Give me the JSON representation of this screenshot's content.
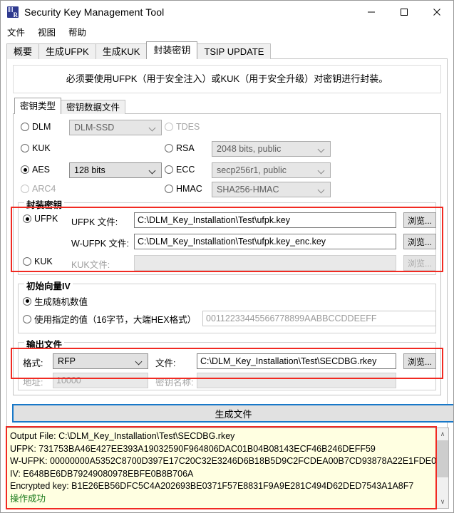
{
  "window": {
    "title": "Security Key Management Tool",
    "icon": "app-icon",
    "minimize": "–",
    "maximize": "□",
    "close": "✕"
  },
  "menu": {
    "items": [
      "文件",
      "视图",
      "帮助"
    ]
  },
  "tabs": {
    "items": [
      {
        "label": "概要",
        "active": false
      },
      {
        "label": "生成UFPK",
        "active": false
      },
      {
        "label": "生成KUK",
        "active": false
      },
      {
        "label": "封装密钥",
        "active": true
      },
      {
        "label": "TSIP UPDATE",
        "active": false
      }
    ]
  },
  "notice": {
    "text": "必须要使用UFPK（用于安全注入）或KUK（用于安全升级）对密钥进行封装。"
  },
  "inner_tabs": {
    "items": [
      {
        "label": "密钥类型",
        "active": true
      },
      {
        "label": "密钥数据文件",
        "active": false
      }
    ]
  },
  "key_type": {
    "left": [
      {
        "label": "DLM",
        "checked": false,
        "disabled": false,
        "combo": "DLM-SSD",
        "combo_enabled": false
      },
      {
        "label": "KUK",
        "checked": false,
        "disabled": false,
        "combo": null
      },
      {
        "label": "AES",
        "checked": true,
        "disabled": false,
        "combo": "128 bits",
        "combo_enabled": true
      },
      {
        "label": "ARC4",
        "checked": false,
        "disabled": true,
        "combo": null
      }
    ],
    "right": [
      {
        "label": "TDES",
        "checked": false,
        "disabled": true,
        "combo": null
      },
      {
        "label": "RSA",
        "checked": false,
        "disabled": false,
        "combo": "2048 bits, public",
        "combo_enabled": false
      },
      {
        "label": "ECC",
        "checked": false,
        "disabled": false,
        "combo": "secp256r1, public",
        "combo_enabled": false
      },
      {
        "label": "HMAC",
        "checked": false,
        "disabled": false,
        "combo": "SHA256-HMAC",
        "combo_enabled": false
      }
    ]
  },
  "wrapping_key": {
    "legend": "封装密钥",
    "ufpk_radio": "UFPK",
    "ufpk_label": "UFPK 文件:",
    "ufpk_value": "C:\\DLM_Key_Installation\\Test\\ufpk.key",
    "ufpk_browse": "浏览...",
    "wufpk_label": "W-UFPK 文件:",
    "wufpk_value": "C:\\DLM_Key_Installation\\Test\\ufpk.key_enc.key",
    "wufpk_browse": "浏览...",
    "kuk_radio": "KUK",
    "kuk_label": "KUK文件:",
    "kuk_value": "",
    "kuk_browse": "浏览..."
  },
  "iv": {
    "legend": "初始向量IV",
    "random_label": "生成随机数值",
    "random_checked": true,
    "specified_label": "使用指定的值（16字节，大端HEX格式）",
    "specified_checked": false,
    "specified_placeholder": "00112233445566778899AABBCCDDEEFF"
  },
  "output": {
    "legend": "输出文件",
    "format_label": "格式:",
    "format_value": "RFP",
    "file_label": "文件:",
    "file_value": "C:\\DLM_Key_Installation\\Test\\SECDBG.rkey",
    "browse": "浏览...",
    "address_label": "地址:",
    "address_value": "10000",
    "keyname_label": "密钥名称:",
    "keyname_value": ""
  },
  "generate_button": {
    "label": "生成文件"
  },
  "log": {
    "lines": [
      "Output File: C:\\DLM_Key_Installation\\Test\\SECDBG.rkey",
      "UFPK: 731753BA46E427EE393A19032590F964806DAC01B04B08143ECF46B246DEFF59",
      "W-UFPK: 00000000A5352C8700D397E17C20C32E3246D6B18B5D9C2FCDEA00B7CD93878A22E1FDE0",
      "IV: E648BE6DB79249080978EBFE0B8B706A",
      "Encrypted key: B1E26EB56DFC5C4A202693BE0371F57E8831F9A9E281C494D62DED7543A1A8F7"
    ],
    "status": "操作成功",
    "status_color": "#1a7a1a",
    "scroll_up": "∧",
    "scroll_down": "∨"
  },
  "colors": {
    "highlight_red": "#f12a22",
    "generate_border": "#1878c8",
    "log_background": "#ffffe1"
  }
}
